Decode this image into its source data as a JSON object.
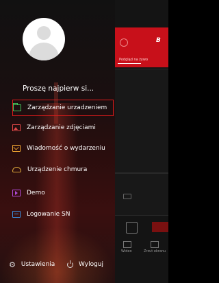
{
  "drawer": {
    "login_prompt": "Proszę najpierw si...",
    "menu": [
      {
        "label": "Zarządzanie urzadzeniem",
        "icon": "folder-icon",
        "active": true
      },
      {
        "label": "Zarządzanie zdjęciami",
        "icon": "image-icon",
        "active": false
      },
      {
        "label": "Wiadomość o wydarzeniu",
        "icon": "message-icon",
        "active": false
      },
      {
        "label": "Urządzenie chmura",
        "icon": "cloud-icon",
        "active": false
      },
      {
        "label": "Demo",
        "icon": "demo-icon",
        "active": false
      },
      {
        "label": "Logowanie SN",
        "icon": "sn-login-icon",
        "active": false
      }
    ],
    "footer": {
      "settings_label": "Ustawienia",
      "logout_label": "Wyloguj"
    }
  },
  "background_app": {
    "tab_live": "Podgląd na żywo",
    "tab_video": "Wideo",
    "tab_screenshot": "Zrzut ekranu"
  },
  "colors": {
    "accent": "#c8101a",
    "active_outline": "#e01b1b"
  }
}
